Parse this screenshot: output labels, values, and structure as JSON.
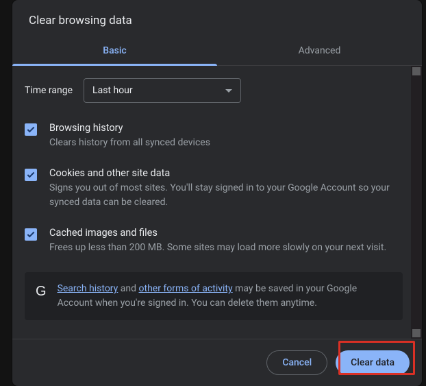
{
  "dialog": {
    "title": "Clear browsing data",
    "tabs": {
      "basic": "Basic",
      "advanced": "Advanced"
    },
    "time_range": {
      "label": "Time range",
      "value": "Last hour"
    },
    "options": [
      {
        "title": "Browsing history",
        "desc": "Clears history from all synced devices"
      },
      {
        "title": "Cookies and other site data",
        "desc": "Signs you out of most sites. You'll stay signed in to your Google Account so your synced data can be cleared."
      },
      {
        "title": "Cached images and files",
        "desc": "Frees up less than 200 MB. Some sites may load more slowly on your next visit."
      }
    ],
    "notice": {
      "link1": "Search history",
      "mid1": " and ",
      "link2": "other forms of activity",
      "tail": " may be saved in your Google Account when you're signed in. You can delete them anytime."
    },
    "buttons": {
      "cancel": "Cancel",
      "clear": "Clear data"
    }
  }
}
